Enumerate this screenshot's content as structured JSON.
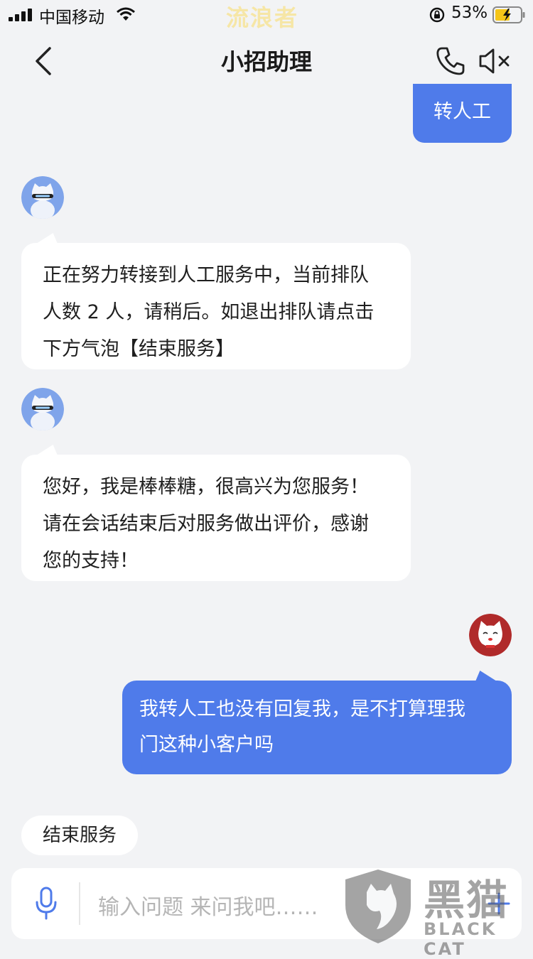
{
  "status": {
    "carrier": "中国移动",
    "center_watermark": "流浪者",
    "battery": "53%"
  },
  "nav": {
    "title": "小招助理"
  },
  "messages": [
    {
      "from": "me",
      "text": "转人工"
    },
    {
      "from": "bot",
      "lines": [
        "正在努力转接到人工服务中，当前排队",
        "人数 2 人，请稍后。如退出排队请点击",
        "下方气泡【结束服务】"
      ]
    },
    {
      "from": "bot",
      "lines": [
        "您好，我是棒棒糖，很高兴为您服务！",
        "请在会话结束后对服务做出评价，感谢",
        "您的支持！"
      ]
    },
    {
      "from": "me",
      "lines": [
        "我转人工也没有回复我，是不打算理我",
        "门这种小客户吗"
      ]
    }
  ],
  "quick_reply": "结束服务",
  "input": {
    "placeholder": "输入问题 来问我吧……"
  },
  "watermark": {
    "cn": "黑猫",
    "en": "BLACK CAT"
  },
  "colors": {
    "accent": "#4f7bea",
    "background": "#f2f3f5",
    "charging": "#f5c518"
  }
}
